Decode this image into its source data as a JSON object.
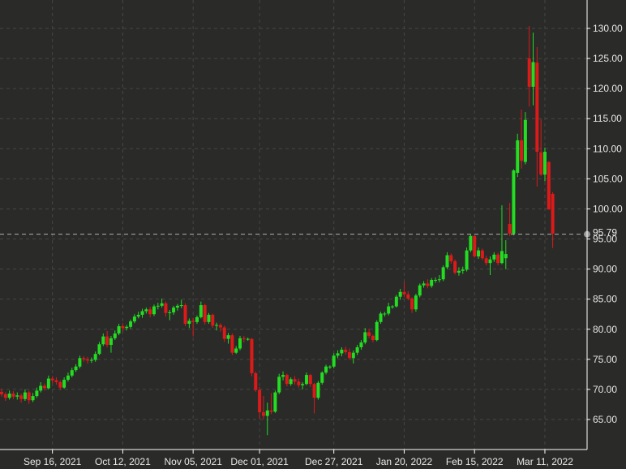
{
  "chart_data": {
    "type": "candlestick",
    "title": "",
    "xlabel": "",
    "ylabel": "",
    "ylim": [
      60,
      133
    ],
    "grid": true,
    "colors": {
      "background": "#2a2a28",
      "up": "#22dd22",
      "down": "#dd1a1a",
      "grid": "#464646",
      "axis": "#ffffff",
      "text": "#e8e8e8",
      "last_price_line": "#b0b0b0"
    },
    "y_ticks": [
      "65.00",
      "70.00",
      "75.00",
      "80.00",
      "85.00",
      "90.00",
      "95.00",
      "100.00",
      "105.00",
      "110.00",
      "115.00",
      "120.00",
      "125.00",
      "130.00"
    ],
    "x_ticks": [
      {
        "label": "Sep 16, 2021",
        "candle": 13
      },
      {
        "label": "Oct 12, 2021",
        "candle": 31
      },
      {
        "label": "Nov 05, 2021",
        "candle": 49
      },
      {
        "label": "Dec 01, 2021",
        "candle": 66
      },
      {
        "label": "Dec 27, 2021",
        "candle": 85
      },
      {
        "label": "Jan 20, 2022",
        "candle": 103
      },
      {
        "label": "Feb 15, 2022",
        "candle": 121
      },
      {
        "label": "Mar 11, 2022",
        "candle": 139
      }
    ],
    "last_price": {
      "value": 95.79,
      "label": "95.79"
    },
    "ohlc_fields": [
      "open",
      "high",
      "low",
      "close"
    ],
    "ohlc": [
      [
        69.6,
        70.1,
        68.8,
        69.2
      ],
      [
        69.2,
        69.5,
        68.1,
        68.6
      ],
      [
        68.6,
        69.8,
        68.3,
        69.3
      ],
      [
        69.3,
        69.7,
        68.4,
        68.8
      ],
      [
        68.8,
        69.5,
        68.3,
        69.0
      ],
      [
        69.0,
        69.3,
        67.8,
        68.4
      ],
      [
        68.4,
        70.0,
        68.1,
        69.5
      ],
      [
        69.5,
        69.8,
        67.6,
        68.2
      ],
      [
        68.2,
        69.4,
        67.9,
        68.9
      ],
      [
        68.9,
        70.3,
        68.6,
        69.8
      ],
      [
        69.8,
        71.2,
        69.5,
        70.6
      ],
      [
        70.6,
        71.0,
        69.8,
        70.2
      ],
      [
        70.2,
        72.3,
        70.0,
        71.8
      ],
      [
        71.8,
        72.2,
        71.0,
        71.5
      ],
      [
        71.5,
        72.0,
        70.8,
        71.2
      ],
      [
        71.2,
        71.5,
        69.9,
        70.3
      ],
      [
        70.3,
        72.0,
        70.1,
        71.6
      ],
      [
        71.6,
        72.8,
        71.3,
        72.3
      ],
      [
        72.3,
        73.6,
        72.0,
        73.2
      ],
      [
        73.2,
        74.2,
        72.9,
        73.8
      ],
      [
        73.8,
        75.6,
        73.5,
        75.2
      ],
      [
        75.2,
        75.5,
        74.6,
        75.0
      ],
      [
        75.0,
        75.4,
        74.3,
        74.8
      ],
      [
        74.8,
        75.3,
        74.4,
        74.9
      ],
      [
        74.9,
        76.3,
        74.6,
        75.9
      ],
      [
        75.9,
        77.9,
        75.7,
        77.5
      ],
      [
        77.5,
        79.3,
        77.2,
        78.8
      ],
      [
        78.8,
        79.7,
        77.0,
        77.4
      ],
      [
        77.4,
        78.9,
        76.1,
        78.5
      ],
      [
        78.5,
        79.8,
        78.2,
        79.3
      ],
      [
        79.3,
        80.9,
        79.0,
        80.5
      ],
      [
        80.5,
        81.0,
        79.6,
        80.2
      ],
      [
        80.2,
        80.7,
        79.8,
        80.4
      ],
      [
        80.4,
        81.6,
        80.1,
        81.3
      ],
      [
        81.3,
        82.5,
        81.0,
        82.1
      ],
      [
        82.1,
        82.9,
        81.8,
        82.4
      ],
      [
        82.4,
        83.4,
        81.9,
        83.0
      ],
      [
        83.0,
        83.6,
        82.6,
        83.3
      ],
      [
        83.3,
        83.7,
        82.0,
        82.5
      ],
      [
        82.5,
        84.1,
        82.2,
        83.8
      ],
      [
        83.8,
        84.4,
        83.3,
        83.9
      ],
      [
        83.9,
        85.1,
        83.6,
        84.3
      ],
      [
        84.3,
        84.6,
        82.1,
        82.7
      ],
      [
        82.7,
        83.2,
        81.5,
        82.8
      ],
      [
        82.8,
        83.9,
        82.4,
        83.6
      ],
      [
        83.6,
        84.2,
        83.1,
        83.9
      ],
      [
        83.9,
        84.9,
        83.5,
        84.0
      ],
      [
        84.0,
        84.3,
        80.5,
        80.9
      ],
      [
        80.9,
        81.8,
        80.2,
        81.4
      ],
      [
        81.4,
        81.9,
        78.8,
        81.2
      ],
      [
        81.2,
        82.3,
        80.9,
        82.0
      ],
      [
        82.0,
        84.6,
        81.8,
        84.0
      ],
      [
        84.0,
        84.2,
        80.8,
        81.2
      ],
      [
        81.2,
        82.7,
        80.9,
        82.4
      ],
      [
        82.4,
        82.6,
        80.2,
        80.6
      ],
      [
        80.6,
        81.1,
        79.8,
        80.7
      ],
      [
        80.7,
        81.0,
        79.6,
        80.3
      ],
      [
        80.3,
        80.6,
        77.9,
        78.4
      ],
      [
        78.4,
        79.4,
        77.6,
        79.0
      ],
      [
        79.0,
        79.3,
        75.7,
        76.1
      ],
      [
        76.1,
        77.2,
        75.9,
        76.8
      ],
      [
        76.8,
        78.9,
        76.5,
        78.5
      ],
      [
        78.5,
        78.9,
        77.8,
        78.4
      ],
      [
        78.4,
        78.6,
        78.1,
        78.4
      ],
      [
        78.4,
        78.5,
        72.2,
        72.7
      ],
      [
        72.7,
        73.0,
        69.6,
        69.9
      ],
      [
        69.9,
        70.4,
        65.1,
        66.2
      ],
      [
        66.2,
        68.9,
        65.0,
        65.6
      ],
      [
        65.6,
        67.8,
        62.4,
        66.5
      ],
      [
        66.5,
        69.4,
        65.9,
        66.3
      ],
      [
        66.3,
        69.8,
        66.1,
        69.5
      ],
      [
        69.5,
        72.6,
        69.2,
        72.1
      ],
      [
        72.1,
        73.0,
        71.5,
        72.4
      ],
      [
        72.4,
        72.6,
        70.5,
        70.9
      ],
      [
        70.9,
        72.0,
        70.6,
        71.7
      ],
      [
        71.7,
        72.2,
        70.8,
        71.3
      ],
      [
        71.3,
        71.8,
        70.3,
        70.7
      ],
      [
        70.7,
        71.2,
        70.0,
        70.9
      ],
      [
        70.9,
        72.8,
        70.7,
        72.4
      ],
      [
        72.4,
        72.6,
        70.4,
        70.9
      ],
      [
        70.9,
        71.1,
        66.0,
        68.6
      ],
      [
        68.6,
        71.4,
        68.3,
        71.1
      ],
      [
        71.1,
        73.0,
        70.8,
        72.8
      ],
      [
        72.8,
        74.1,
        72.5,
        73.8
      ],
      [
        73.8,
        74.0,
        73.4,
        73.8
      ],
      [
        73.8,
        76.0,
        73.5,
        75.6
      ],
      [
        75.6,
        76.5,
        75.2,
        76.0
      ],
      [
        76.0,
        77.0,
        75.5,
        76.6
      ],
      [
        76.6,
        77.1,
        75.8,
        76.2
      ],
      [
        76.2,
        76.8,
        74.9,
        75.2
      ],
      [
        75.2,
        76.5,
        74.3,
        76.1
      ],
      [
        76.1,
        77.4,
        75.7,
        77.0
      ],
      [
        77.0,
        78.2,
        76.6,
        77.8
      ],
      [
        77.8,
        80.2,
        77.5,
        79.5
      ],
      [
        79.5,
        80.1,
        78.5,
        78.9
      ],
      [
        78.9,
        79.1,
        77.8,
        78.2
      ],
      [
        78.2,
        81.5,
        78.0,
        81.2
      ],
      [
        81.2,
        82.9,
        80.9,
        82.6
      ],
      [
        82.6,
        82.9,
        82.1,
        82.6
      ],
      [
        82.6,
        84.4,
        82.3,
        83.8
      ],
      [
        83.8,
        84.0,
        83.4,
        83.8
      ],
      [
        83.8,
        85.7,
        83.6,
        85.4
      ],
      [
        85.4,
        86.7,
        84.9,
        86.2
      ],
      [
        86.2,
        87.9,
        85.3,
        85.8
      ],
      [
        85.8,
        86.3,
        84.8,
        85.1
      ],
      [
        85.1,
        85.3,
        82.7,
        83.3
      ],
      [
        83.3,
        85.9,
        82.9,
        85.6
      ],
      [
        85.6,
        87.6,
        85.3,
        87.3
      ],
      [
        87.3,
        88.0,
        86.9,
        87.6
      ],
      [
        87.6,
        88.3,
        86.8,
        87.2
      ],
      [
        87.2,
        88.5,
        86.9,
        88.2
      ],
      [
        88.2,
        88.6,
        87.7,
        88.2
      ],
      [
        88.2,
        89.0,
        87.8,
        88.3
      ],
      [
        88.3,
        90.6,
        88.0,
        90.3
      ],
      [
        90.3,
        92.8,
        90.0,
        92.3
      ],
      [
        92.3,
        92.6,
        90.9,
        91.3
      ],
      [
        91.3,
        91.6,
        89.1,
        89.4
      ],
      [
        89.4,
        90.3,
        88.9,
        89.7
      ],
      [
        89.7,
        90.4,
        89.2,
        89.9
      ],
      [
        89.9,
        93.6,
        89.6,
        93.1
      ],
      [
        93.1,
        95.8,
        92.8,
        95.5
      ],
      [
        95.5,
        95.6,
        91.9,
        92.1
      ],
      [
        92.1,
        93.6,
        91.7,
        93.1
      ],
      [
        93.1,
        93.4,
        91.5,
        91.8
      ],
      [
        91.8,
        92.2,
        90.6,
        91.0
      ],
      [
        91.0,
        92.1,
        89.0,
        91.6
      ],
      [
        91.6,
        92.8,
        91.2,
        92.4
      ],
      [
        92.4,
        92.7,
        90.6,
        91.0
      ],
      [
        91.0,
        100.6,
        90.8,
        93.0
      ],
      [
        91.8,
        94.8,
        90.0,
        92.5
      ],
      [
        97.5,
        101.0,
        95.5,
        95.9
      ],
      [
        95.9,
        106.6,
        95.6,
        106.4
      ],
      [
        106.0,
        112.5,
        105.3,
        111.4
      ],
      [
        111.4,
        116.5,
        106.7,
        108.0
      ],
      [
        107.8,
        116.1,
        107.4,
        114.8
      ],
      [
        125.0,
        130.4,
        117.0,
        120.3
      ],
      [
        120.3,
        129.3,
        117.2,
        124.4
      ],
      [
        124.3,
        126.9,
        103.7,
        109.5
      ],
      [
        109.4,
        114.9,
        105.5,
        105.7
      ],
      [
        105.7,
        110.2,
        104.6,
        109.5
      ],
      [
        107.8,
        107.9,
        99.9,
        99.9
      ],
      [
        102.5,
        102.8,
        93.5,
        95.9
      ]
    ]
  }
}
